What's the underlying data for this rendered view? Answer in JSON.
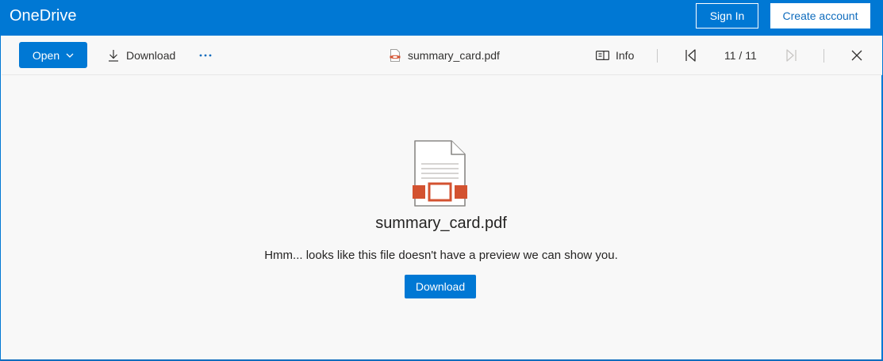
{
  "header": {
    "brand": "OneDrive",
    "sign_in_label": "Sign In",
    "create_account_label": "Create account"
  },
  "toolbar": {
    "open_label": "Open",
    "download_label": "Download",
    "more_label": "···",
    "file_name": "summary_card.pdf",
    "info_label": "Info",
    "page_indicator": "11 / 11"
  },
  "preview": {
    "file_name": "summary_card.pdf",
    "message": "Hmm... looks like this file doesn't have a preview we can show you.",
    "download_label": "Download"
  },
  "colors": {
    "brand_blue": "#0078d4",
    "pdf_red": "#d35230"
  },
  "icons": [
    "chevron-down-icon",
    "download-icon",
    "more-icon",
    "pdf-file-icon",
    "info-icon",
    "first-page-icon",
    "last-page-icon",
    "close-icon",
    "document-icon"
  ]
}
